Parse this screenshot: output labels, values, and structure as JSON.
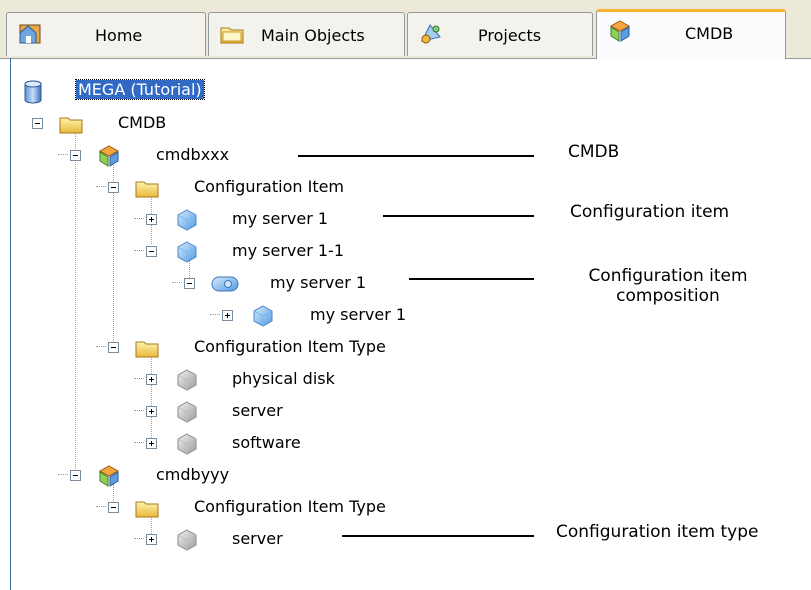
{
  "tabs": [
    {
      "label": "Home",
      "icon": "home-icon"
    },
    {
      "label": "Main Objects",
      "icon": "folder-icon"
    },
    {
      "label": "Projects",
      "icon": "projects-icon"
    },
    {
      "label": "CMDB",
      "icon": "cmdb-icon",
      "active": true
    }
  ],
  "tree": {
    "root": "MEGA (Tutorial)",
    "cmdb_folder": "CMDB",
    "cmdbxxx": "cmdbxxx",
    "ci_folder": "Configuration Item",
    "server1": "my server 1",
    "server1_1": "my server 1-1",
    "composition": "my server 1",
    "composed_server": "my server 1",
    "cit_folder": "Configuration Item Type",
    "type_disk": "physical disk",
    "type_server": "server",
    "type_software": "software",
    "cmdbyyy": "cmdbyyy",
    "cit_folder2": "Configuration Item Type",
    "type_server2": "server"
  },
  "callouts": {
    "cmdb": "CMDB",
    "ci": "Configuration item",
    "composition_line1": "Configuration item",
    "composition_line2": "composition",
    "ci_type": "Configuration item type"
  }
}
